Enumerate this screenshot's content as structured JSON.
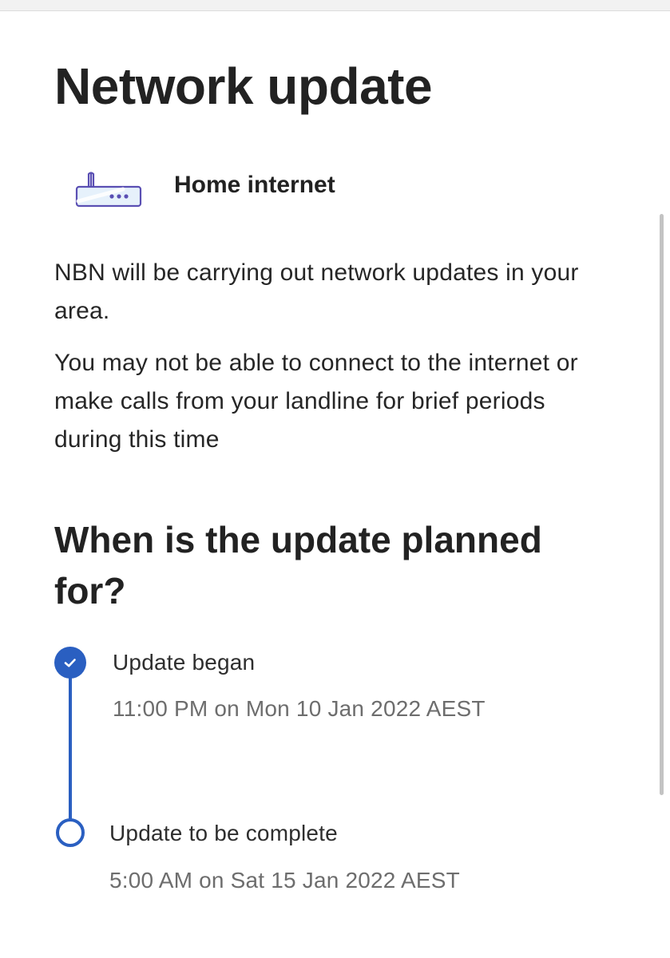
{
  "page": {
    "title": "Network update"
  },
  "service": {
    "icon": "router-icon",
    "name": "Home internet"
  },
  "notice": {
    "paragraph_1": "NBN will be carrying out network updates in your area.",
    "paragraph_2": "You may not be able to connect to the internet or make calls from your landline for brief periods during this time"
  },
  "schedule": {
    "heading": "When is the update planned for?",
    "steps": [
      {
        "label": "Update began",
        "time": "11:00 PM on Mon 10 Jan 2022 AEST",
        "status": "complete",
        "icon": "check-icon"
      },
      {
        "label": "Update to be complete",
        "time": "5:00 AM on Sat 15 Jan 2022 AEST",
        "status": "pending",
        "icon": "empty-circle-icon"
      }
    ]
  },
  "colors": {
    "accent": "#2a5fc1",
    "icon_stroke": "#5a4fb3",
    "icon_fill": "#e6f1fb",
    "text_primary": "#222222",
    "text_secondary": "#6d6d6d"
  }
}
